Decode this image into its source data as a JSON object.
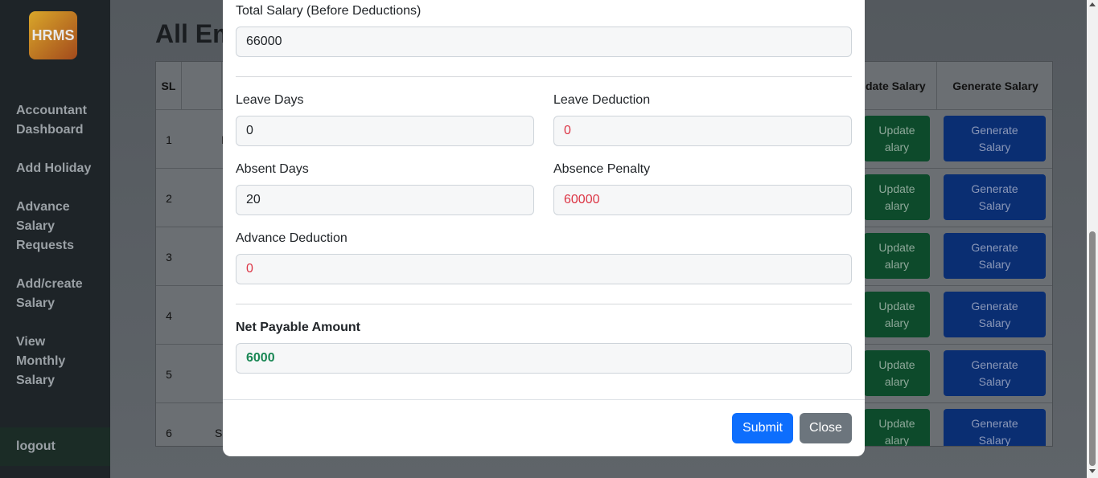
{
  "sidebar": {
    "logo": "HRMS",
    "items": [
      {
        "label": "Accountant Dashboard"
      },
      {
        "label": "Add Holiday"
      },
      {
        "label": "Advance Salary Requests"
      },
      {
        "label": "Add/create Salary"
      },
      {
        "label": "View Monthly Salary"
      }
    ],
    "logout": "logout"
  },
  "page": {
    "title": "All Em",
    "table": {
      "headers": {
        "sl": "SL",
        "update": "date Salary",
        "generate": "Generate Salary"
      },
      "rows": [
        {
          "sl": "1",
          "name_fragment": "I"
        },
        {
          "sl": "2",
          "name_fragment": ""
        },
        {
          "sl": "3",
          "name_fragment": ""
        },
        {
          "sl": "4",
          "name_fragment": ""
        },
        {
          "sl": "5",
          "name_fragment": ""
        },
        {
          "sl": "6",
          "name_fragment": "Sa"
        }
      ],
      "update_btn": "Update\nalary",
      "generate_btn": "Generate\nSalary"
    }
  },
  "modal": {
    "total_salary_label": "Total Salary (Before Deductions)",
    "total_salary_value": "66000",
    "leave_days_label": "Leave Days",
    "leave_days_value": "0",
    "leave_deduction_label": "Leave Deduction",
    "leave_deduction_value": "0",
    "absent_days_label": "Absent Days",
    "absent_days_value": "20",
    "absence_penalty_label": "Absence Penalty",
    "absence_penalty_value": "60000",
    "advance_deduction_label": "Advance Deduction",
    "advance_deduction_value": "0",
    "net_payable_label": "Net Payable Amount",
    "net_payable_value": "6000",
    "submit_label": "Submit",
    "close_label": "Close"
  }
}
